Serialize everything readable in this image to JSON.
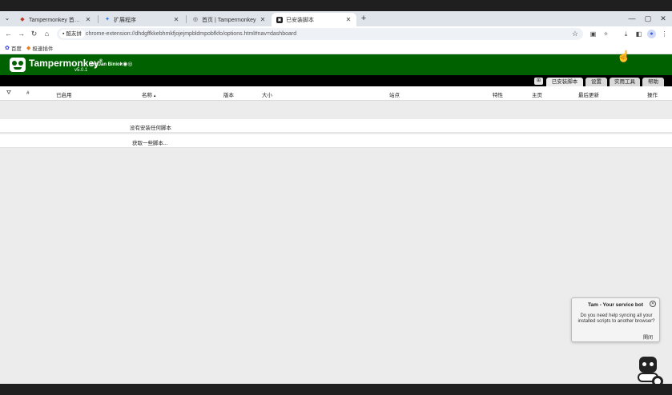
{
  "browser": {
    "tabs": [
      {
        "title": "Tampermonkey 首次使用说明 |",
        "active": false
      },
      {
        "title": "扩展程序",
        "active": false
      },
      {
        "title": "首页 | Tampermonkey",
        "active": false
      },
      {
        "title": "已安装脚本",
        "active": true
      }
    ],
    "url_chip": "酷友拼",
    "url": "chrome-extension://dhdgffkkebhmkfjojejmpbldmpobfkfo/options.html#nav=dashboard",
    "bookmarks": [
      {
        "label": "百度"
      },
      {
        "label": "极速插件"
      }
    ]
  },
  "app": {
    "name": "Tampermonkey",
    "reg_mark": "®",
    "by": "by Jan Biniok",
    "version": "v5.0.1",
    "nav_tabs": [
      {
        "label": "已安装脚本",
        "active": true
      },
      {
        "label": "设置",
        "active": false
      },
      {
        "label": "实用工具",
        "active": false
      },
      {
        "label": "帮助",
        "active": false
      }
    ],
    "table_headers": {
      "number": "#",
      "enabled": "已启用",
      "name": "名称",
      "version": "版本",
      "size": "大小",
      "sites": "站点",
      "features": "特性",
      "homepage": "主页",
      "last_updated": "最后更新",
      "actions": "操作"
    },
    "rows": [
      {
        "text": "没有安装任何脚本"
      },
      {
        "text": "获取一些脚本..."
      }
    ]
  },
  "bot": {
    "title": "Tam - Your service bot",
    "message": "Do you need help syncing all your installed scripts to another browser?",
    "action": "関闭"
  }
}
